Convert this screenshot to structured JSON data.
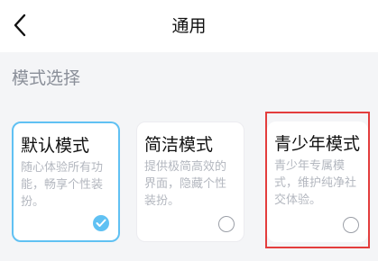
{
  "header": {
    "title": "通用",
    "back_icon": "chevron-left-icon"
  },
  "section": {
    "title": "模式选择"
  },
  "modes": [
    {
      "title": "默认模式",
      "description": "随心体验所有功能，畅享个性装扮。",
      "selected": true
    },
    {
      "title": "简洁模式",
      "description": "提供极简高效的界面，隐藏个性装扮。",
      "selected": false
    },
    {
      "title": "青少年模式",
      "description": "青少年专属模式，维护纯净社交体验。",
      "selected": false
    }
  ],
  "colors": {
    "accent": "#60c1f3",
    "highlight": "#e33d3d",
    "background": "#f4f5f7"
  }
}
